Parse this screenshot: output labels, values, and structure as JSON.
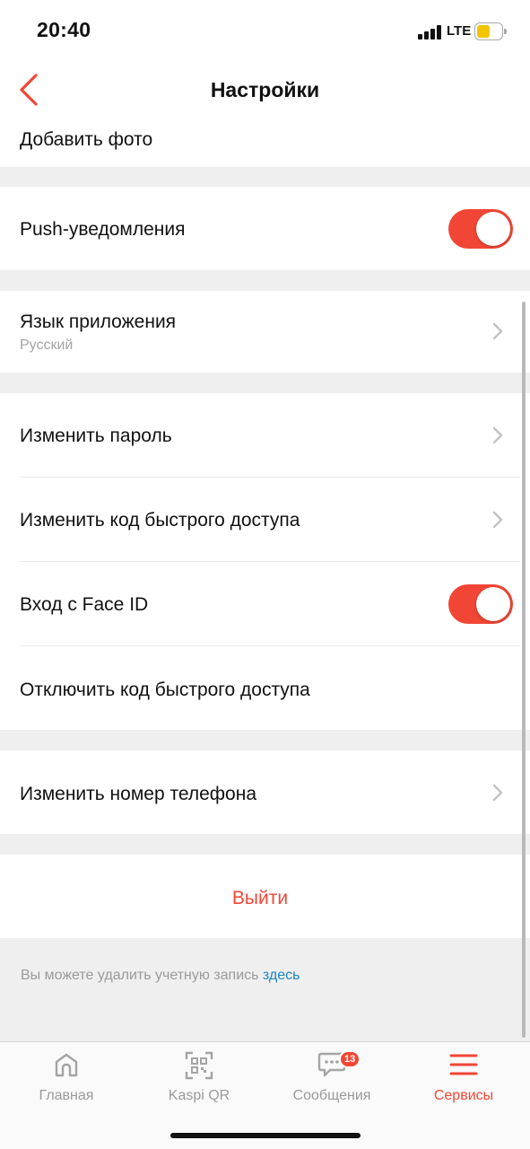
{
  "status_bar": {
    "time": "20:40",
    "network": "LTE"
  },
  "header": {
    "title": "Настройки"
  },
  "settings": {
    "add_photo": "Добавить фото",
    "push_notifications": {
      "label": "Push-уведомления",
      "enabled": true
    },
    "app_language": {
      "label": "Язык приложения",
      "value": "Русский"
    },
    "change_password": "Изменить пароль",
    "change_quick_code": "Изменить код быстрого доступа",
    "face_id": {
      "label": "Вход с Face ID",
      "enabled": true
    },
    "disable_quick_code": "Отключить код быстрого доступа",
    "change_phone": "Изменить номер телефона",
    "logout": "Выйти"
  },
  "footer": {
    "note": "Вы можете удалить учетную запись",
    "link": "здесь"
  },
  "tabbar": {
    "tabs": [
      {
        "label": "Главная",
        "icon": "home-icon"
      },
      {
        "label": "Kaspi QR",
        "icon": "qr-code-icon"
      },
      {
        "label": "Сообщения",
        "icon": "chat-icon",
        "badge": "13"
      },
      {
        "label": "Сервисы",
        "icon": "menu-icon",
        "active": true
      }
    ]
  },
  "colors": {
    "accent": "#f14635",
    "link": "#1a86c8",
    "separator": "#efefef"
  }
}
